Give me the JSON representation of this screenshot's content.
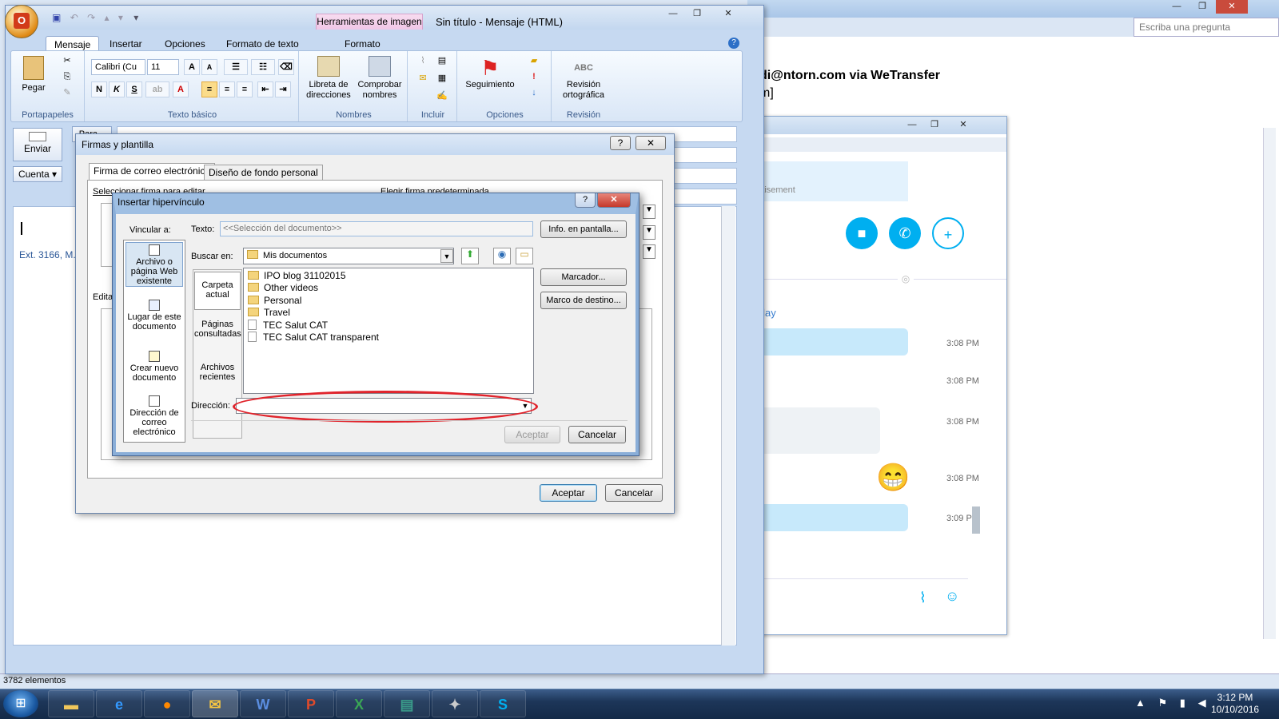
{
  "background_outlook": {
    "help_placeholder": "Escriba una pregunta",
    "sender_line": "di@ntorn.com via WeTransfer",
    "sender_line2": "m]",
    "status": "3782 elementos"
  },
  "skype": {
    "ad_text": "vertisement",
    "today": "Today",
    "timestamps": [
      "3:08 PM",
      "3:08 PM",
      "3:08 PM",
      "3:08 PM",
      "3:08 PM",
      "3:09 PM"
    ],
    "emoji": "😁"
  },
  "message_window": {
    "title": "Sin título - Mensaje (HTML)",
    "tools_tab": "Herramientas de imagen",
    "tabs": [
      "Mensaje",
      "Insertar",
      "Opciones",
      "Formato de texto",
      "Formato"
    ],
    "ribbon": {
      "paste": "Pegar",
      "clipboard_group": "Portapapeles",
      "font_name": "Calibri (Cu",
      "font_size": "11",
      "basic_text_group": "Texto básico",
      "bold": "N",
      "italic": "K",
      "underline": "S",
      "address_book": "Libreta de direcciones",
      "check_names": "Comprobar nombres",
      "names_group": "Nombres",
      "include_group": "Incluir",
      "followup": "Seguimiento",
      "options_group": "Opciones",
      "spelling": "Revisión ortográfica",
      "review_group": "Revisión",
      "abc": "ABC"
    },
    "send": "Enviar",
    "account": "Cuenta",
    "to_label": "Para...",
    "ext_text": "Ext. 3166, M..."
  },
  "firmas": {
    "title": "Firmas y plantilla",
    "tabs": [
      "Firma de correo electrónico",
      "Diseño de fondo personal"
    ],
    "select_label": "Seleccionar firma para editar",
    "default_label": "Elegir firma predeterminada",
    "edit_label": "Edita",
    "accept": "Aceptar",
    "cancel": "Cancelar"
  },
  "hyperlink": {
    "title": "Insertar hipervínculo",
    "link_to": "Vincular a:",
    "text_label": "Texto:",
    "text_value": "<<Selección del documento>>",
    "screen_tip": "Info. en pantalla...",
    "search_in": "Buscar en:",
    "folder": "Mis documentos",
    "bookmark": "Marcador...",
    "target_frame": "Marco de destino...",
    "address_label": "Dirección:",
    "accept": "Aceptar",
    "cancel": "Cancelar",
    "link_options": [
      "Archivo o página Web existente",
      "Lugar de este documento",
      "Crear nuevo documento",
      "Dirección de correo electrónico"
    ],
    "browse_options": [
      "Carpeta actual",
      "Páginas consultadas",
      "Archivos recientes"
    ],
    "files": [
      {
        "name": "IPO blog 31102015",
        "type": "folder"
      },
      {
        "name": "Other videos",
        "type": "folder"
      },
      {
        "name": "Personal",
        "type": "folder"
      },
      {
        "name": "Travel",
        "type": "folder"
      },
      {
        "name": "TEC Salut CAT",
        "type": "file"
      },
      {
        "name": "TEC Salut CAT transparent",
        "type": "file"
      }
    ]
  },
  "taskbar": {
    "time": "3:12 PM",
    "date": "10/10/2016"
  },
  "colors": {
    "accent": "#c6d9f1",
    "skype_blue": "#00aff0",
    "highlight": "#e0232b"
  }
}
